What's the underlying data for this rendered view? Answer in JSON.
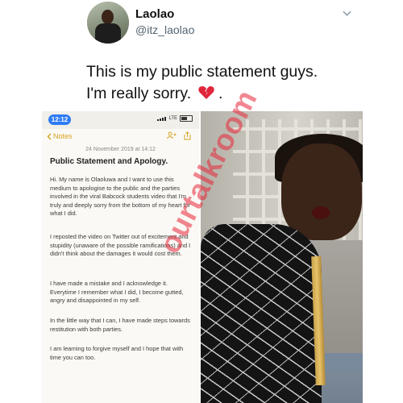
{
  "tweet": {
    "display_name": "Laolao",
    "handle": "@itz_laolao",
    "text_line1": "This is my public statement guys.",
    "text_line2": "I'm really sorry.",
    "emoji": "broken-heart-icon"
  },
  "notes": {
    "status_time": "12:12",
    "status_network": "LTE",
    "back_label": "Notes",
    "date": "24 November 2019 at 14:12",
    "title": "Public Statement and Apology.",
    "paragraphs": [
      "Hi. My name is Olaoluwa and I want to use this medium to apologise to the public and the parties involved in the viral Babcock students video that I'm truly and deeply sorry from the bottom of my heart for what I did.",
      "I reposted the video on Twitter out of excitement and stupidity (unaware of the possible ramifications) and I didn't think about the damages it would cost them.",
      "I have made a mistake and I acknowledge it. Everytime I remember what I did, I become gutted, angry and disappointed in my self.",
      "In the little way that I can, I have made steps towards restitution with both parties.",
      "I am learning to forgive myself and I hope that with time you can too."
    ]
  },
  "watermark": "ourtalkroom",
  "colors": {
    "accent_notes": "#d6a21e",
    "time_pill": "#2f7cf6",
    "watermark": "#e8283a",
    "handle": "#536471"
  }
}
